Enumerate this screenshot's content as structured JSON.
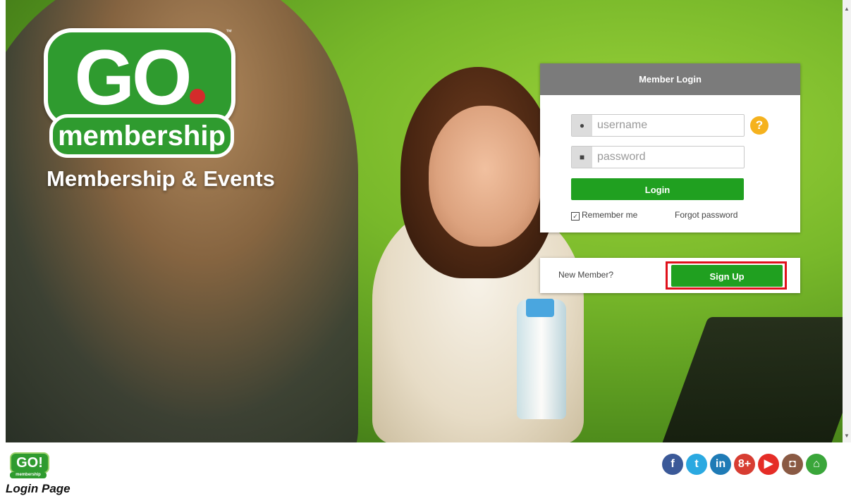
{
  "brand": {
    "logo_go": "GO",
    "logo_word": "membership",
    "logo_tm": "™",
    "tagline": "Membership & Events"
  },
  "login": {
    "header": "Member Login",
    "username_placeholder": "username",
    "password_placeholder": "password",
    "help_glyph": "?",
    "login_label": "Login",
    "remember_label": "Remember me",
    "remember_checked": true,
    "forgot_label": "Forgot password"
  },
  "signup": {
    "prompt": "New Member?",
    "button_label": "Sign Up",
    "highlight_color": "#e0111b"
  },
  "footer": {
    "logo_go": "GO!",
    "logo_word": "membership",
    "caption": "Login Page"
  },
  "social": [
    {
      "name": "facebook-icon",
      "glyph": "f",
      "color": "#3b5998"
    },
    {
      "name": "twitter-icon",
      "glyph": "t",
      "color": "#2ba9e1"
    },
    {
      "name": "linkedin-icon",
      "glyph": "in",
      "color": "#1f7bb6"
    },
    {
      "name": "google-plus-icon",
      "glyph": "8+",
      "color": "#d73d32"
    },
    {
      "name": "youtube-icon",
      "glyph": "▶",
      "color": "#e52d27"
    },
    {
      "name": "instagram-icon",
      "glyph": "◘",
      "color": "#8a5a44"
    },
    {
      "name": "home-icon",
      "glyph": "⌂",
      "color": "#3aa63a"
    }
  ],
  "colors": {
    "accent_green": "#20a020",
    "header_gray": "#7b7b7b",
    "help_orange": "#f5b21e"
  }
}
